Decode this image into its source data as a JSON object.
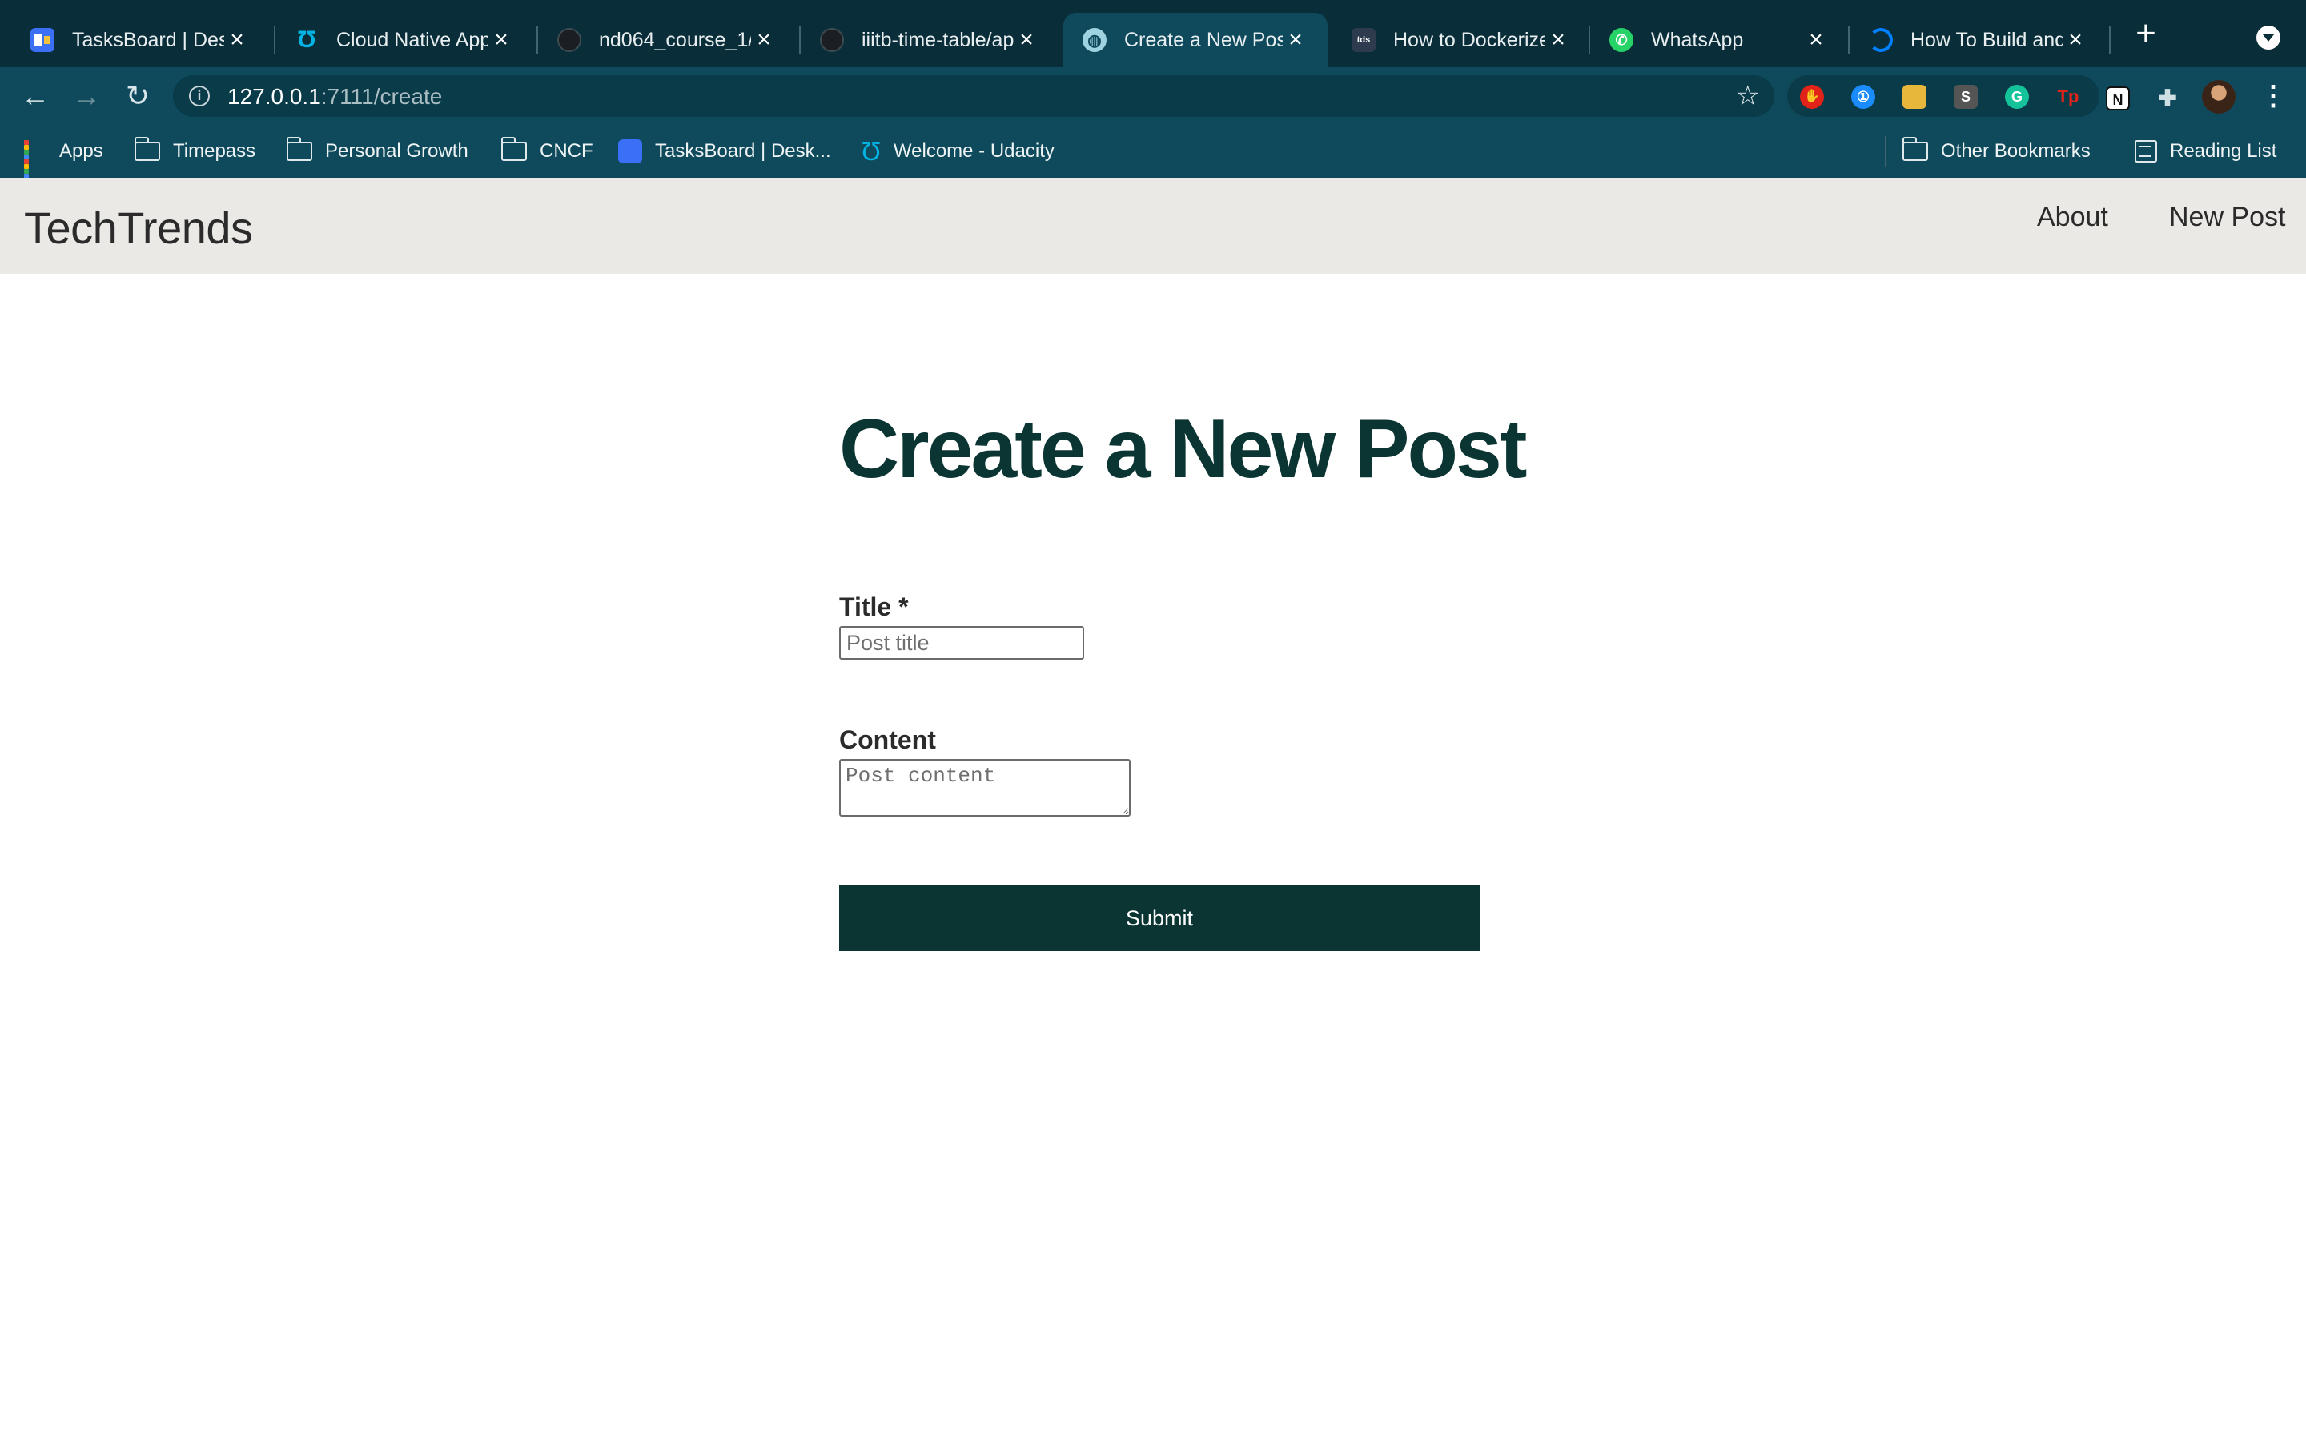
{
  "browser": {
    "tabs": [
      {
        "title": "TasksBoard | Desk",
        "icon": "tasksboard-icon",
        "color": "#3b6ff5"
      },
      {
        "title": "Cloud Native App",
        "icon": "udacity-icon",
        "color": "#02b3e4"
      },
      {
        "title": "nd064_course_1/",
        "icon": "github-icon",
        "color": "#1b1f23"
      },
      {
        "title": "iiitb-time-table/ap",
        "icon": "github-icon",
        "color": "#1b1f23"
      },
      {
        "title": "Create a New Pos",
        "icon": "globe-icon",
        "color": "#9fd3e0",
        "active": true
      },
      {
        "title": "How to Dockerize",
        "icon": "tds-icon",
        "color": "#2e3b4e"
      },
      {
        "title": "WhatsApp",
        "icon": "whatsapp-icon",
        "color": "#25d366"
      },
      {
        "title": "How To Build and",
        "icon": "digitalocean-icon",
        "color": "#0080ff"
      }
    ],
    "url": {
      "host": "127.0.0.1",
      "path": ":7111/create"
    },
    "extensions": [
      {
        "icon": "adblock-icon",
        "color": "#e2231a",
        "glyph": "✋"
      },
      {
        "icon": "onepassword-icon",
        "color": "#1a8cff",
        "glyph": "①"
      },
      {
        "icon": "image-extension-icon",
        "color": "#e6b73a",
        "glyph": "▬"
      },
      {
        "icon": "s-extension-icon",
        "color": "#555555",
        "glyph": "S"
      },
      {
        "icon": "grammarly-icon",
        "color": "#15c39a",
        "glyph": "G"
      },
      {
        "icon": "tp-extension-icon",
        "color": "#e2231a",
        "glyph": "Tp"
      },
      {
        "icon": "notion-icon",
        "color": "#111111",
        "glyph": "N"
      },
      {
        "icon": "puzzle-icon",
        "color": "#cfe0e4",
        "glyph": "✚"
      }
    ],
    "bookmarks": [
      {
        "label": "Apps",
        "icon": "apps-grid-icon"
      },
      {
        "label": "Timepass",
        "icon": "folder-icon"
      },
      {
        "label": "Personal Growth",
        "icon": "folder-icon"
      },
      {
        "label": "CNCF",
        "icon": "folder-icon"
      },
      {
        "label": "TasksBoard | Desk...",
        "icon": "tasksboard-icon"
      },
      {
        "label": "Welcome - Udacity",
        "icon": "udacity-icon"
      }
    ],
    "other_bookmarks": "Other Bookmarks",
    "reading_list": "Reading List"
  },
  "site": {
    "brand": "TechTrends",
    "nav": {
      "about": "About",
      "new_post": "New Post"
    }
  },
  "form": {
    "heading": "Create a New Post",
    "title_label": "Title *",
    "title_placeholder": "Post title",
    "content_label": "Content",
    "content_placeholder": "Post content",
    "submit_label": "Submit"
  }
}
